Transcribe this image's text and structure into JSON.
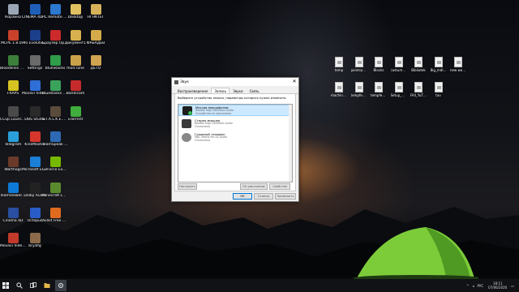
{
  "desktop_left": [
    {
      "label": "Корзина",
      "color": "#9aa6b5"
    },
    {
      "label": "CINEMA 4D R20",
      "color": "#1f5fb8"
    },
    {
      "label": "PC Remote Receive",
      "color": "#2c79cf"
    },
    {
      "label": "Desktop",
      "color": "#e0c060"
    },
    {
      "label": "НГНКТЕГ",
      "color": "#d6b35a"
    },
    {
      "label": "MCPE 1.8.0.7",
      "color": "#c8412b"
    },
    {
      "label": "Pro Evolution Soccer 2016",
      "color": "#1c3f8b"
    },
    {
      "label": "Браузер Opera",
      "color": "#cc2a2a"
    },
    {
      "label": "Документ1",
      "color": "#d9b04f"
    },
    {
      "label": "ФАБАДЕВ",
      "color": "#d4aa4a"
    },
    {
      "label": "Bloodlines DXS",
      "color": "#3b7f3a"
    },
    {
      "label": "Settings",
      "color": "#6a6a6a"
    },
    {
      "label": "BlueStacks",
      "color": "#2f9d4a"
    },
    {
      "label": "mod.rune",
      "color": "#c9a24a"
    },
    {
      "label": "ДЕТО",
      "color": "#d0a450"
    },
    {
      "label": "FRAPS",
      "color": "#d6c321"
    },
    {
      "label": "Movavi Video Suite 18",
      "color": "#2f6ed6"
    },
    {
      "label": "Bluestacks Multi-Insta...",
      "color": "#3aa35b"
    },
    {
      "label": "Bandicam",
      "color": "#c52b2b"
    },
    {
      "label": "CCup Launcher",
      "color": "#4a4a4a"
    },
    {
      "label": "OBS Studio",
      "color": "#2a2a2a"
    },
    {
      "label": "S.T.A.L.K.E.R. Зов Припяти",
      "color": "#5a4b3a"
    },
    {
      "label": "uTorrent",
      "color": "#3fae3c"
    },
    {
      "label": "Telegram",
      "color": "#2aa0da"
    },
    {
      "label": "KineMaster",
      "color": "#d6362c"
    },
    {
      "label": "TeamSpeak 3 Client",
      "color": "#2d6ab3"
    },
    {
      "label": "Warthogs",
      "color": "#6b3a2a"
    },
    {
      "label": "Microsoft Edge",
      "color": "#1c7fd6"
    },
    {
      "label": "GeForce Experience",
      "color": "#76b900"
    },
    {
      "label": "TeamViewer 14",
      "color": "#0e7ad8"
    },
    {
      "label": "Dolby Audio",
      "color": "#222222"
    },
    {
      "label": "Minecraft Launcher",
      "color": "#5b8a2e"
    },
    {
      "label": "Cinema 4D",
      "color": "#2a4fa0"
    },
    {
      "label": "Octopus",
      "color": "#2a5cc8"
    },
    {
      "label": "Avast Free Antivirus",
      "color": "#e06b1f"
    },
    {
      "label": "Movavi Video Editor 14 Plus",
      "color": "#c23a2a"
    },
    {
      "label": "bry.bfg",
      "color": "#8a6a4a"
    }
  ],
  "desktop_files_row1": [
    "temp",
    "pointsoff...",
    "Blocks",
    "costume_s...",
    "Bibliotek",
    "Big_mdli_full",
    "new world3"
  ],
  "desktop_files_row2": [
    "machine_autd...",
    "tempfeatures...",
    "tempfeature...",
    "Setup_Rig...",
    "FAll_YuTU...",
    "tav"
  ],
  "dialog": {
    "title": "Звук",
    "close": "✕",
    "tabs": [
      "Воспроизведение",
      "Запись",
      "Звуки",
      "Связь"
    ],
    "active_tab": 1,
    "instruction": "Выберите устройство записи, параметры которого нужно изменить:",
    "devices": [
      {
        "name": "Массив микрофонов",
        "sub": "Realtek High Definition Audio",
        "status": "Устройство по умолчанию",
        "default": true
      },
      {
        "name": "Стерео микшер",
        "sub": "Realtek High Definition Audio",
        "status": "Отключено",
        "default": false
      },
      {
        "name": "Головной телефон",
        "sub": "SBIC Redmi Pro A2 Audio",
        "status": "Отключено",
        "default": false
      }
    ],
    "configure": "Настроить",
    "set_default": "По умолчанию",
    "properties": "Свойства",
    "ok": "ОК",
    "cancel": "Отмена",
    "apply": "Применить"
  },
  "taskbar": {
    "start_icon": "windows-icon",
    "items": [
      "search-icon",
      "task-view-icon",
      "file-explorer-icon",
      "settings-icon"
    ],
    "clock_time": "18:11",
    "clock_date": "07/06/2020",
    "lang": "РУС"
  },
  "colors": {
    "selection": "#cce8ff",
    "accent": "#0078d7",
    "tent": "#7ccc3a"
  }
}
